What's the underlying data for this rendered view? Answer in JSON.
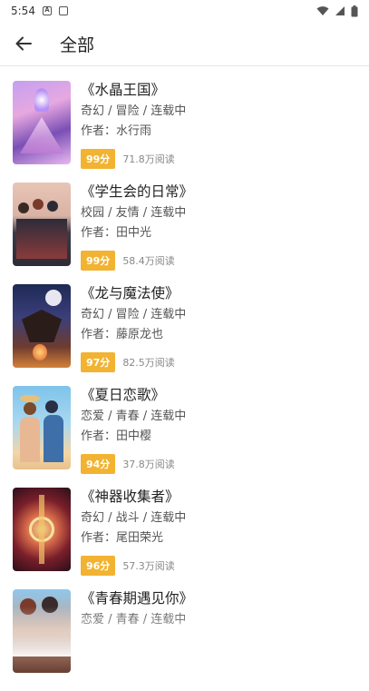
{
  "status": {
    "time": "5:54"
  },
  "header": {
    "title": "全部"
  },
  "books": [
    {
      "title": "《水晶王国》",
      "tags": "奇幻 / 冒险 / 连载中",
      "author": "作者：水行雨",
      "score": "99分",
      "reads": "71.8万阅读"
    },
    {
      "title": "《学生会的日常》",
      "tags": "校园 / 友情 / 连载中",
      "author": "作者：田中光",
      "score": "99分",
      "reads": "58.4万阅读"
    },
    {
      "title": "《龙与魔法使》",
      "tags": "奇幻 / 冒险 / 连载中",
      "author": "作者：藤原龙也",
      "score": "97分",
      "reads": "82.5万阅读"
    },
    {
      "title": "《夏日恋歌》",
      "tags": "恋爱 / 青春 / 连载中",
      "author": "作者：田中樱",
      "score": "94分",
      "reads": "37.8万阅读"
    },
    {
      "title": "《神器收集者》",
      "tags": "奇幻 / 战斗 / 连载中",
      "author": "作者：尾田荣光",
      "score": "96分",
      "reads": "57.3万阅读"
    },
    {
      "title": "《青春期遇见你》",
      "tags": "恋爱 / 青春 / 连载中",
      "author": "",
      "score": "",
      "reads": ""
    }
  ],
  "colors": {
    "score_badge": "#f2b332",
    "divider": "#e6e6e6"
  }
}
